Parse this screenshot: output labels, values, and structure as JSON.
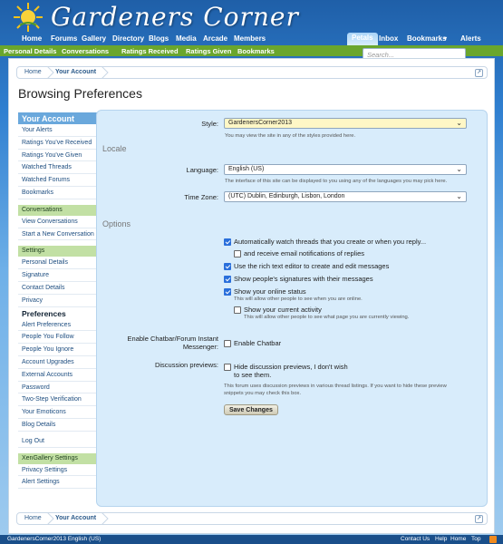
{
  "site": {
    "title": "Gardeners Corner"
  },
  "nav": {
    "items": [
      "Home",
      "Forums",
      "Gallery",
      "Directory",
      "Blogs",
      "Media",
      "Arcade",
      "Members"
    ],
    "right_items": [
      "Petals",
      "Inbox",
      "Bookmarks",
      "Alerts"
    ]
  },
  "subnav": {
    "items": [
      "Personal Details",
      "Conversations",
      "Ratings Received",
      "Ratings Given",
      "Bookmarks"
    ],
    "search_placeholder": "Search..."
  },
  "breadcrumb": {
    "home": "Home",
    "current": "Your Account"
  },
  "page": {
    "title": "Browsing Preferences"
  },
  "sidebar": {
    "header": "Your Account",
    "group1": [
      "Your Alerts",
      "Ratings You've Received",
      "Ratings You've Given",
      "Watched Threads",
      "Watched Forums",
      "Bookmarks"
    ],
    "conv_head": "Conversations",
    "group2": [
      "View Conversations",
      "Start a New Conversation"
    ],
    "settings_head": "Settings",
    "group3a": [
      "Personal Details",
      "Signature",
      "Contact Details",
      "Privacy"
    ],
    "preferences": "Preferences",
    "group3b": [
      "Alert Preferences",
      "People You Follow",
      "People You Ignore",
      "Account Upgrades",
      "External Accounts",
      "Password",
      "Two-Step Verification",
      "Your Emoticons",
      "Blog Details"
    ],
    "logout": "Log Out",
    "xen_head": "XenGallery Settings",
    "group4": [
      "Privacy Settings",
      "Alert Settings"
    ]
  },
  "form": {
    "style_label": "Style:",
    "style_value": "GardenersCorner2013",
    "style_hint": "You may view the site in any of the styles provided here.",
    "locale_title": "Locale",
    "language_label": "Language:",
    "language_value": "English (US)",
    "language_hint": "The interface of this site can be displayed to you using any of the languages you may pick here.",
    "timezone_label": "Time Zone:",
    "timezone_value": "(UTC) Dublin, Edinburgh, Lisbon, London",
    "options_title": "Options",
    "opt_watch": "Automatically watch threads that you create or when you reply...",
    "opt_email": "and receive email notifications of replies",
    "opt_rte": "Use the rich text editor to create and edit messages",
    "opt_sig": "Show people's signatures with their messages",
    "opt_online": "Show your online status",
    "opt_online_hint": "This will allow other people to see when you are online.",
    "opt_activity": "Show your current activity",
    "opt_activity_hint": "This will allow other people to see what page you are currently viewing.",
    "chatbar_label_1": "Enable Chatbar/Forum Instant",
    "chatbar_label_2": "Messenger:",
    "chatbar_cb": "Enable Chatbar",
    "disc_label": "Discussion previews:",
    "disc_cb_1": "Hide discussion previews, I don't wish",
    "disc_cb_2": "to see them.",
    "disc_hint_1": "This forum uses discussion previews in various thread listings. If you want to hide these preview",
    "disc_hint_2": "snippets you may check this box.",
    "save_label": "Save Changes"
  },
  "footer": {
    "left": "GardenersCorner2013   English (US)",
    "links": [
      "Contact Us",
      "Help",
      "Home",
      "Top"
    ]
  },
  "colors": {
    "accent_green": "#6aa62d",
    "accent_blue": "#6aa8dc"
  }
}
